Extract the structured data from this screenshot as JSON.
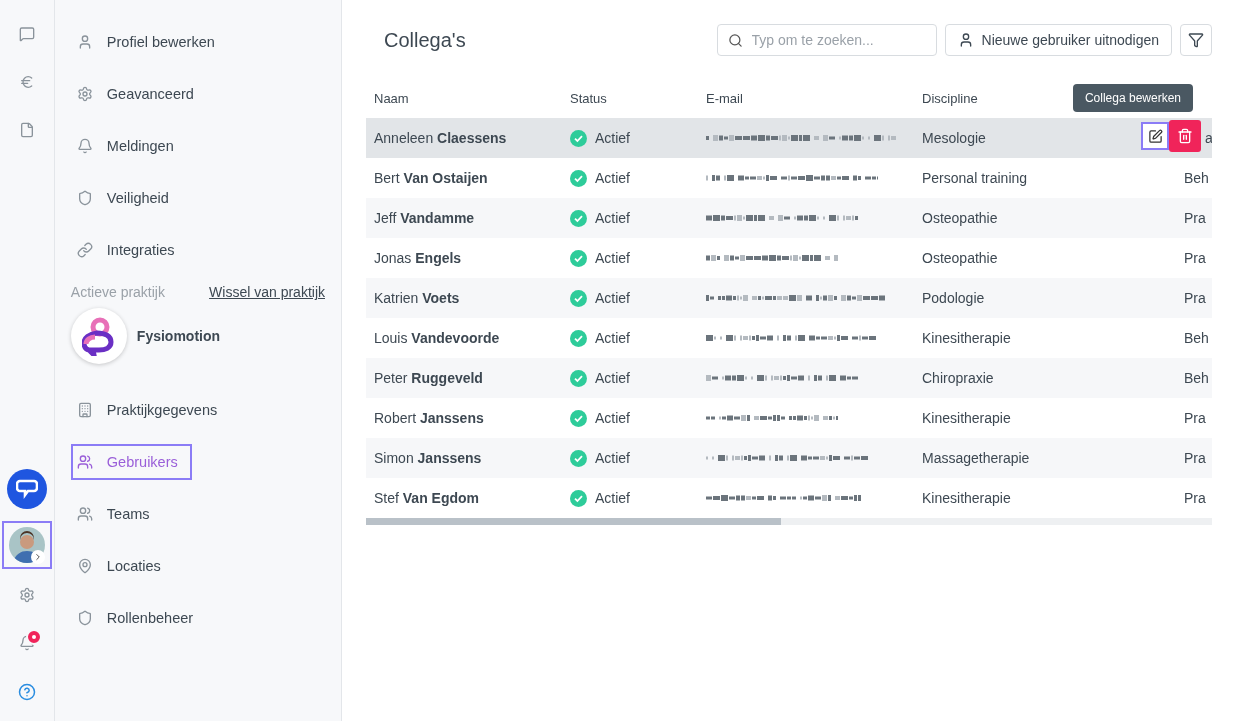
{
  "rail": {
    "avatar": {
      "selected": true
    },
    "notifications": {
      "unread": true
    }
  },
  "settings_menu": {
    "items": [
      {
        "label": "Profiel bewerken",
        "selected": false
      },
      {
        "label": "Geavanceerd",
        "selected": false
      },
      {
        "label": "Meldingen",
        "selected": false
      },
      {
        "label": "Veiligheid",
        "selected": false
      },
      {
        "label": "Integraties",
        "selected": false
      }
    ],
    "practice": {
      "heading": "Actieve praktijk",
      "switch_link": "Wissel van praktijk",
      "name": "Fysiomotion"
    },
    "practice_items": [
      {
        "label": "Praktijkgegevens",
        "selected": false
      },
      {
        "label": "Gebruikers",
        "selected": true
      },
      {
        "label": "Teams",
        "selected": false
      },
      {
        "label": "Locaties",
        "selected": false
      },
      {
        "label": "Rollenbeheer",
        "selected": false
      }
    ]
  },
  "page": {
    "title": "Collega's",
    "search": {
      "placeholder": "Typ om te zoeken..."
    },
    "invite_button": "Nieuwe gebruiker uitnodigen"
  },
  "table": {
    "columns": [
      "Naam",
      "Status",
      "E-mail",
      "Discipline"
    ],
    "rows": [
      {
        "name": "Anneleen **Claessens**",
        "status": "Actief",
        "discipline": "Mesologie",
        "column_5": "a",
        "selected": true,
        "tooltip": "Collega bewerken"
      },
      {
        "name": "Bert **Van Ostaijen**",
        "status": "Actief",
        "discipline": "Personal training",
        "column_5": "Beh",
        "selected": false
      },
      {
        "name": "Jeff **Vandamme**",
        "status": "Actief",
        "discipline": "Osteopathie",
        "column_5": "Pra",
        "selected": false
      },
      {
        "name": "Jonas **Engels**",
        "status": "Actief",
        "discipline": "Osteopathie",
        "column_5": "Pra",
        "selected": false
      },
      {
        "name": "Katrien **Voets**",
        "status": "Actief",
        "discipline": "Podologie",
        "column_5": "Pra",
        "selected": false
      },
      {
        "name": "Louis **Vandevoorde**",
        "status": "Actief",
        "discipline": "Kinesitherapie",
        "column_5": "Beh",
        "selected": false
      },
      {
        "name": "Peter **Ruggeveld**",
        "status": "Actief",
        "discipline": "Chiropraxie",
        "column_5": "Beh",
        "selected": false
      },
      {
        "name": "Robert **Janssens**",
        "status": "Actief",
        "discipline": "Kinesitherapie",
        "column_5": "Pra",
        "selected": false
      },
      {
        "name": "Simon **Janssens**",
        "status": "Actief",
        "discipline": "Massagetherapie",
        "column_5": "Pra",
        "selected": false
      },
      {
        "name": "Stef **Van Egdom**",
        "status": "Actief",
        "discipline": "Kinesitherapie",
        "column_5": "Pra",
        "selected": false
      }
    ]
  }
}
